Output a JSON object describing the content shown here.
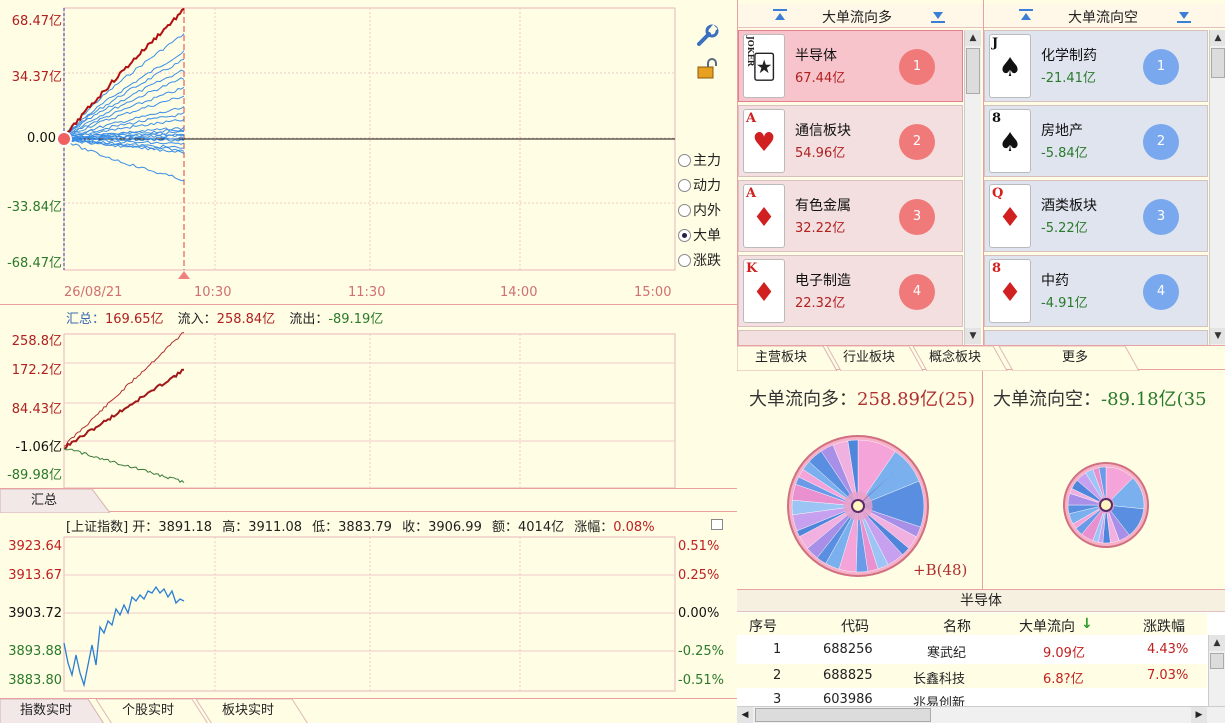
{
  "chart_main": {
    "type": "line",
    "y_ticks": [
      "68.47亿",
      "34.37亿",
      "0.00",
      "-33.84亿",
      "-68.47亿"
    ],
    "x_ticks": [
      "26/08/21",
      "10:30",
      "11:30",
      "14:00",
      "15:00"
    ],
    "modes": [
      {
        "label": "主力",
        "selected": false
      },
      {
        "label": "动力",
        "selected": false
      },
      {
        "label": "内外",
        "selected": false
      },
      {
        "label": "大单",
        "selected": true
      },
      {
        "label": "涨跌",
        "selected": false
      }
    ],
    "colors": {
      "lead": "#b01010",
      "others": "#3a8ee6"
    }
  },
  "chart_summary": {
    "type": "line",
    "header": {
      "total_label": "汇总：",
      "total": "169.65亿",
      "in_label": "流入：",
      "in": "258.84亿",
      "out_label": "流出：",
      "out": "-89.19亿"
    },
    "y_ticks": [
      "258.8亿",
      "172.2亿",
      "84.43亿",
      "-1.06亿",
      "-89.98亿"
    ],
    "tab": "汇总",
    "colors": {
      "net": "#a01818",
      "inflow": "#b03030",
      "outflow": "#3a7a3a"
    }
  },
  "chart_index": {
    "type": "line",
    "header": {
      "name": "[上证指数]",
      "open_label": "开：",
      "open": "3891.18",
      "high_label": "高：",
      "high": "3911.08",
      "low_label": "低：",
      "low": "3883.79",
      "close_label": "收：",
      "close": "3906.99",
      "amt_label": "额：",
      "amt": "4014亿",
      "chg_label": "涨幅：",
      "chg": "0.08%"
    },
    "y_ticks_left": [
      "3923.64",
      "3913.67",
      "3903.72",
      "3893.88",
      "3883.80"
    ],
    "y_ticks_right": [
      "0.51%",
      "0.25%",
      "0.00%",
      "-0.25%",
      "-0.51%"
    ],
    "colors": {
      "up": "#c02020",
      "flat": "#111111",
      "down": "#2a7a2a",
      "line": "#2a7ed6"
    }
  },
  "bottom_tabs": [
    "指数实时",
    "个股实时",
    "板块实时"
  ],
  "inflow_panel": {
    "title": "大单流向多",
    "items": [
      {
        "card": "JOKER",
        "suit": "",
        "name": "半导体",
        "value": "67.44亿",
        "rank": "1"
      },
      {
        "card": "A",
        "suit": "♥",
        "name": "通信板块",
        "value": "54.96亿",
        "rank": "2"
      },
      {
        "card": "A",
        "suit": "♦",
        "name": "有色金属",
        "value": "32.22亿",
        "rank": "3"
      },
      {
        "card": "K",
        "suit": "♦",
        "name": "电子制造",
        "value": "22.32亿",
        "rank": "4"
      }
    ]
  },
  "outflow_panel": {
    "title": "大单流向空",
    "items": [
      {
        "card": "J",
        "suit": "♠",
        "name": "化学制药",
        "value": "-21.41亿",
        "rank": "1"
      },
      {
        "card": "8",
        "suit": "♠",
        "name": "房地产",
        "value": "-5.84亿",
        "rank": "2"
      },
      {
        "card": "Q",
        "suit": "♦",
        "name": "酒类板块",
        "value": "-5.22亿",
        "rank": "3"
      },
      {
        "card": "8",
        "suit": "♦",
        "name": "中药",
        "value": "-4.91亿",
        "rank": "4"
      }
    ]
  },
  "sector_tabs": [
    "主营板块",
    "行业板块",
    "概念板块",
    "更多"
  ],
  "pie_left": {
    "title": "大单流向多：",
    "value": "258.89亿",
    "count": "(25)",
    "note": "+B(48)"
  },
  "pie_right": {
    "title": "大单流向空：",
    "value": "-89.18亿",
    "count": "(35"
  },
  "table": {
    "title": "半导体",
    "columns": [
      "序号",
      "代码",
      "名称",
      "大单流向",
      "涨跌幅"
    ],
    "rows": [
      {
        "no": "1",
        "code": "688256",
        "name": "寒武纪",
        "flow": "9.09亿",
        "chg": "4.43%"
      },
      {
        "no": "2",
        "code": "688825",
        "name": "长鑫科技",
        "flow": "6.8?亿",
        "chg": "7.03%"
      },
      {
        "no": "3",
        "code": "603986",
        "name": "兆易创新",
        "flow": "",
        "chg": ""
      }
    ]
  }
}
